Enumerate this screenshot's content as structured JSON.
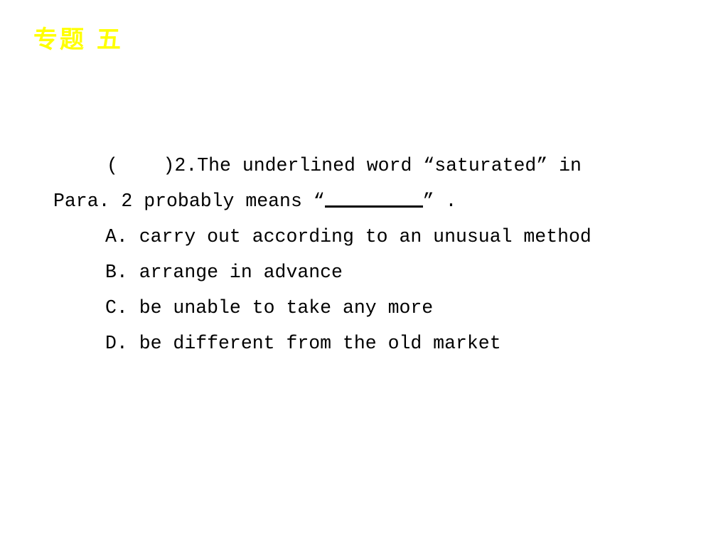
{
  "slide": {
    "title": "专题 五",
    "title_color": "#ffff00",
    "background_color": "#ffffff",
    "text_color": "#000000"
  },
  "question": {
    "checkbox_marker": "(    )",
    "number": "2.",
    "stem_part1": "The underlined word ",
    "quoted_word": "“saturated”",
    "stem_part2": " in",
    "line2_part1": "Para. 2 probably means ",
    "line2_open_quote": "“",
    "line2_blank": "________",
    "line2_close_quote": "”",
    "line2_period": " ."
  },
  "options": [
    {
      "letter": "A.",
      "text": " carry out according to an unusual method"
    },
    {
      "letter": "B.",
      "text": " arrange in advance"
    },
    {
      "letter": "C.",
      "text": " be unable to take any more"
    },
    {
      "letter": "D.",
      "text": " be different from the old market"
    }
  ]
}
